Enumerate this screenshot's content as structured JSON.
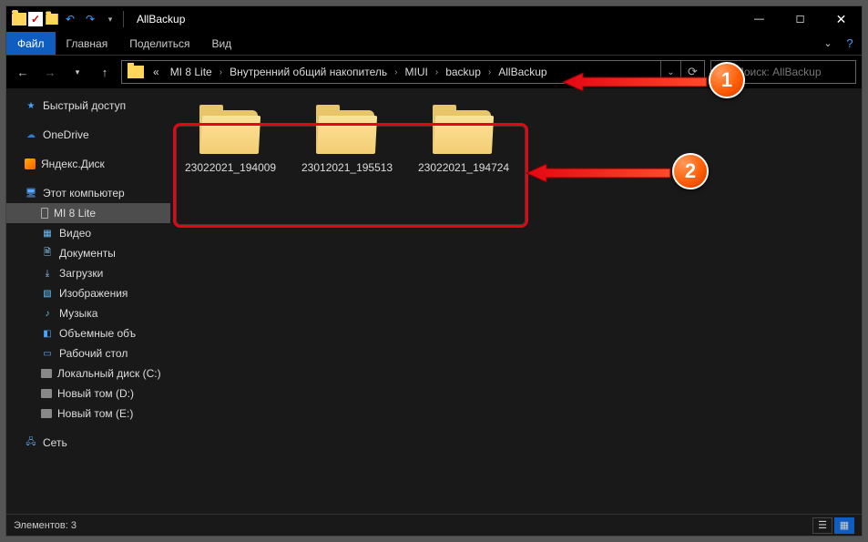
{
  "window": {
    "title": "AllBackup"
  },
  "ribbon": {
    "file": "Файл",
    "home": "Главная",
    "share": "Поделиться",
    "view": "Вид"
  },
  "breadcrumbs": {
    "prefix": "«",
    "items": [
      "MI 8 Lite",
      "Внутренний общий накопитель",
      "MIUI",
      "backup",
      "AllBackup"
    ]
  },
  "search": {
    "placeholder": "Поиск: AllBackup"
  },
  "sidebar": {
    "quick": "Быстрый доступ",
    "onedrive": "OneDrive",
    "yandex": "Яндекс.Диск",
    "thispc": "Этот компьютер",
    "mi8": "MI 8 Lite",
    "video": "Видео",
    "docs": "Документы",
    "downloads": "Загрузки",
    "images": "Изображения",
    "music": "Музыка",
    "objects3d": "Объемные объ",
    "desktop": "Рабочий стол",
    "diskc": "Локальный диск (C:)",
    "diskd": "Новый том (D:)",
    "diske": "Новый том (E:)",
    "network": "Сеть"
  },
  "folders": [
    {
      "name": "23022021_194009"
    },
    {
      "name": "23012021_195513"
    },
    {
      "name": "23022021_194724"
    }
  ],
  "status": {
    "count_label": "Элементов: 3"
  }
}
